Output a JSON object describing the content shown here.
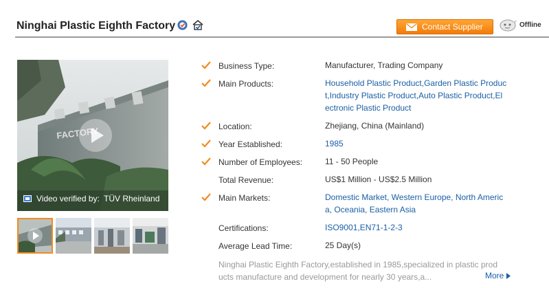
{
  "header": {
    "company_name": "Ninghai Plastic Eighth Factory",
    "contact_label": "Contact Supplier",
    "status_label": "Offline",
    "verified_icon": "verified-badge-icon",
    "gold_icon": "gold-supplier-icon"
  },
  "video": {
    "caption_label": "Video verified by:",
    "caption_verifier": "TÜV Rheinland",
    "sign_text": "FACTORY"
  },
  "thumbnails": [
    "factory-video",
    "factory-exterior",
    "workshop",
    "production-line"
  ],
  "details": [
    {
      "label": "Business Type:",
      "value": "Manufacturer, Trading Company",
      "checked": true,
      "link": false
    },
    {
      "label": "Main Products:",
      "value_lines": [
        "Household Plastic Product,Garden Plastic Produc",
        "t,Industry Plastic Product,Auto Plastic Product,El",
        "ectronic Plastic Product"
      ],
      "checked": true,
      "link": true
    },
    {
      "label": "Location:",
      "value": "Zhejiang, China (Mainland)",
      "checked": true,
      "link": false
    },
    {
      "label": "Year Established:",
      "value": "1985",
      "checked": true,
      "link": true
    },
    {
      "label": "Number of Employees:",
      "value": "11 - 50 People",
      "checked": true,
      "link": false
    },
    {
      "label": "Total Revenue:",
      "value": "US$1 Million - US$2.5 Million",
      "checked": false,
      "link": false
    },
    {
      "label": "Main Markets:",
      "value_lines": [
        "Domestic Market, Western Europe, North Americ",
        "a, Oceania, Eastern Asia"
      ],
      "checked": true,
      "link": true
    },
    {
      "label": "Certifications:",
      "value": "ISO9001,EN71-1-2-3",
      "checked": false,
      "link": true
    },
    {
      "label": "Average Lead Time:",
      "value": "25 Day(s)",
      "checked": false,
      "link": false
    }
  ],
  "description": {
    "line1": "Ninghai Plastic Eighth Factory,established in 1985,specialized in plastic prod",
    "line2": "ucts manufacture and development for nearly 30 years,a...",
    "more_label": "More"
  },
  "colors": {
    "accent_orange": "#f28a1e",
    "link_blue": "#1a5fa5",
    "muted_text": "#999999"
  }
}
